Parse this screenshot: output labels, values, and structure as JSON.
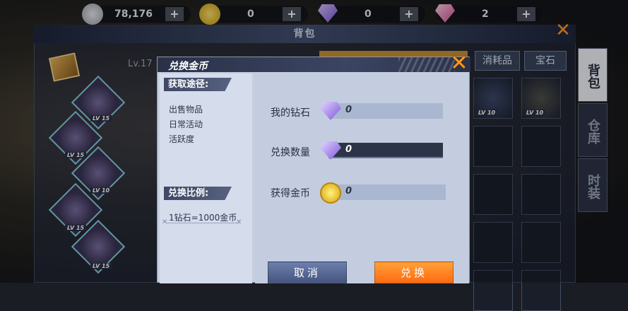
{
  "resources": [
    {
      "icon": "silver-coin-icon",
      "value": "78,176",
      "plus": "+"
    },
    {
      "icon": "gold-coin-icon",
      "value": "0",
      "plus": "+"
    },
    {
      "icon": "purple-diamond-icon",
      "value": "0",
      "plus": "+"
    },
    {
      "icon": "pink-gem-icon",
      "value": "2",
      "plus": "+"
    }
  ],
  "bag": {
    "title": "背包",
    "level": "Lv.17",
    "tabs": [
      "消耗品",
      "宝石"
    ],
    "side_tabs": [
      "背包",
      "仓库",
      "时装"
    ],
    "equip_levels": [
      "LV 15",
      "LV 15",
      "LV 10",
      "LV 15",
      "LV 15"
    ],
    "grid_levels": [
      "LV 10",
      "LV 10"
    ]
  },
  "dialog": {
    "title": "兑换金币",
    "sources_header": "获取途径:",
    "sources": [
      "出售物品",
      "日常活动",
      "活跃度"
    ],
    "ratio_header": "兑换比例:",
    "ratio_text": "1钻石=1000金币",
    "rows": [
      {
        "label": "我的钻石",
        "icon": "purple-diamond-icon",
        "value": "0"
      },
      {
        "label": "兑换数量",
        "icon": "purple-diamond-icon",
        "value": "0"
      },
      {
        "label": "获得金币",
        "icon": "gold-coin-icon",
        "value": "0"
      }
    ],
    "cancel_label": "取消",
    "confirm_label": "兑换"
  },
  "colors": {
    "accent_orange": "#ff7a1a",
    "header_navy": "#2a3148",
    "cancel_blue": "#5a6a98"
  }
}
